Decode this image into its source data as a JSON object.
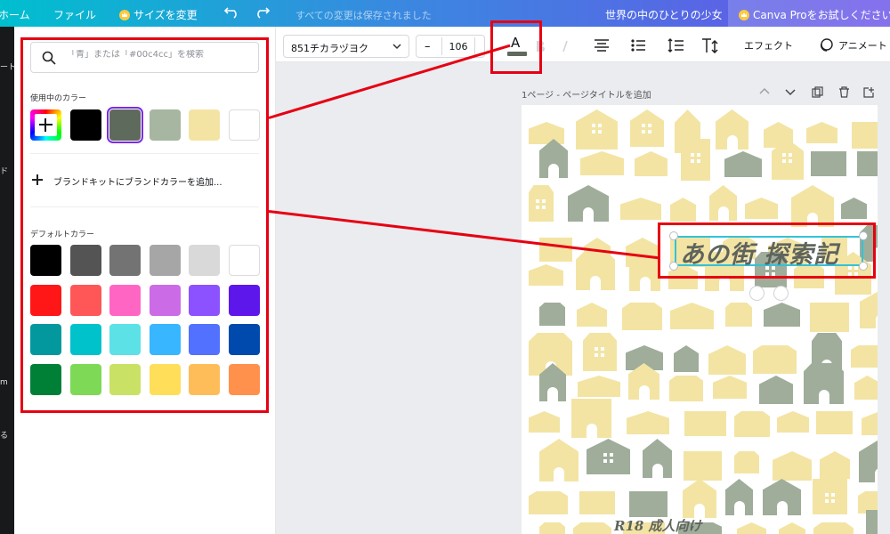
{
  "topbar": {
    "home": "ホーム",
    "file": "ファイル",
    "resize": "サイズを変更",
    "saved_status": "すべての変更は保存されました",
    "doc_title": "世界の中のひとりの少女",
    "try_pro": "Canva Proをお試しください"
  },
  "rail": {
    "items": [
      "ート",
      "ド",
      "m",
      "る"
    ]
  },
  "color_panel": {
    "search_placeholder": "「青」または「#00c4cc」を検索",
    "in_use_title": "使用中のカラー",
    "in_use_colors": [
      "#000000",
      "#5e6a5c",
      "#a7b6a0",
      "#f4e4a3",
      "#ffffff"
    ],
    "selected_color": "#5e6a5c",
    "brand_add": "ブランドキットにブランドカラーを追加...",
    "default_title": "デフォルトカラー",
    "default_colors": [
      [
        "#000000",
        "#545454",
        "#737373",
        "#a6a6a6",
        "#d9d9d9",
        "#ffffff"
      ],
      [
        "#ff1616",
        "#ff5757",
        "#ff66c4",
        "#cb6ce6",
        "#8c52ff",
        "#5e17eb"
      ],
      [
        "#03989e",
        "#00c2cb",
        "#5ce1e6",
        "#38b6ff",
        "#5271ff",
        "#004aad"
      ],
      [
        "#008037",
        "#7ed957",
        "#c9e265",
        "#ffde59",
        "#ffbd59",
        "#ff914d"
      ]
    ]
  },
  "toolbar": {
    "font_name": "851チカラヅヨク",
    "font_size": "106",
    "minus": "–",
    "effects": "エフェクト",
    "animate": "アニメート",
    "text_color_glyph": "A"
  },
  "page": {
    "header": "1ページ - ページタイトルを追加",
    "title_text": "あの街 探索記",
    "subtitle_text": "R18 成人向け"
  },
  "colors": {
    "accent_red": "#e60012",
    "selection": "#33c2d8",
    "pro_purple": "#7d2ae8"
  }
}
